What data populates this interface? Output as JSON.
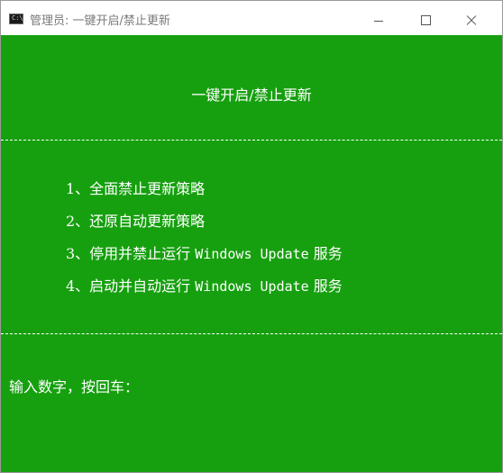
{
  "window": {
    "title": "管理员: 一键开启/禁止更新",
    "icon": "cmd-console-icon",
    "icon_prompt": "C:\\_"
  },
  "controls": [
    "minimize",
    "maximize",
    "close"
  ],
  "console": {
    "background": "#16a00f",
    "text_color": "#ffffff",
    "heading": "一键开启/禁止更新",
    "menu": [
      {
        "prefix": "1、全面禁止更新策略",
        "ascii": "",
        "suffix": ""
      },
      {
        "prefix": "2、还原自动更新策略",
        "ascii": "",
        "suffix": ""
      },
      {
        "prefix": "3、停用并禁止运行 ",
        "ascii": "Windows Update",
        "suffix": " 服务"
      },
      {
        "prefix": "4、启动并自动运行 ",
        "ascii": "Windows Update",
        "suffix": " 服务"
      }
    ],
    "prompt": "输入数字，按回车："
  }
}
